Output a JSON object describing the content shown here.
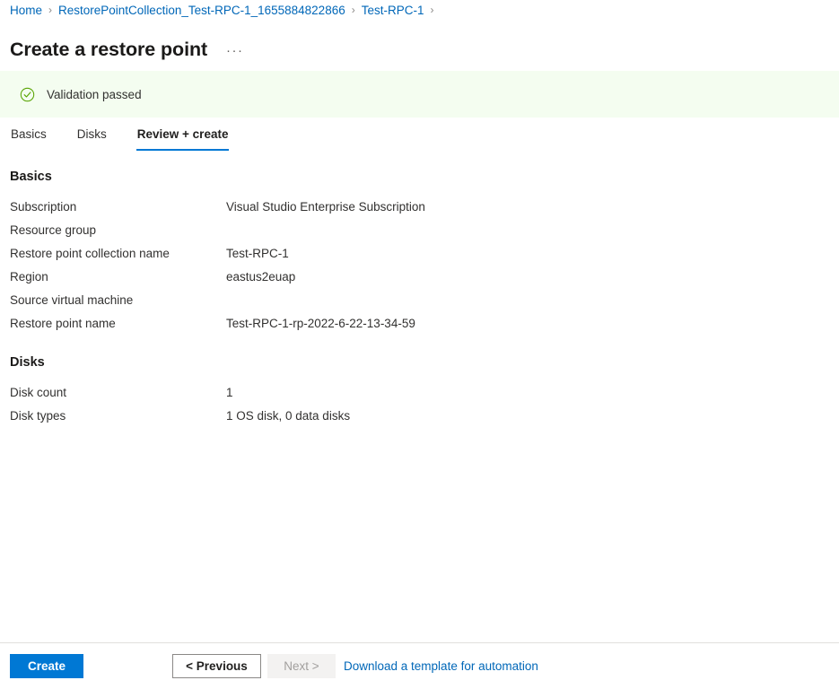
{
  "breadcrumb": {
    "separator": "›",
    "items": [
      {
        "label": "Home"
      },
      {
        "label": "RestorePointCollection_Test-RPC-1_1655884822866"
      },
      {
        "label": "Test-RPC-1"
      }
    ],
    "trailing_separator": "›"
  },
  "header": {
    "title": "Create a restore point",
    "more_menu": "···"
  },
  "validation": {
    "icon": "check-circle-icon",
    "message": "Validation passed",
    "background_color": "#f4fdf0",
    "icon_color": "#57a300"
  },
  "tabs": [
    {
      "label": "Basics",
      "active": false
    },
    {
      "label": "Disks",
      "active": false
    },
    {
      "label": "Review + create",
      "active": true
    }
  ],
  "sections": [
    {
      "heading": "Basics",
      "rows": [
        {
          "label": "Subscription",
          "value": "Visual Studio Enterprise Subscription"
        },
        {
          "label": "Resource group",
          "value": ""
        },
        {
          "label": "Restore point collection name",
          "value": "Test-RPC-1"
        },
        {
          "label": "Region",
          "value": "eastus2euap"
        },
        {
          "label": "Source virtual machine",
          "value": ""
        },
        {
          "label": "Restore point name",
          "value": "Test-RPC-1-rp-2022-6-22-13-34-59"
        }
      ]
    },
    {
      "heading": "Disks",
      "rows": [
        {
          "label": "Disk count",
          "value": "1"
        },
        {
          "label": "Disk types",
          "value": "1 OS disk, 0 data disks"
        }
      ]
    }
  ],
  "footer": {
    "create_label": "Create",
    "previous_label": "< Previous",
    "next_label": "Next >",
    "next_disabled": true,
    "download_template_label": "Download a template for automation",
    "accent_color": "#0078d4",
    "link_color": "#0067b8"
  }
}
